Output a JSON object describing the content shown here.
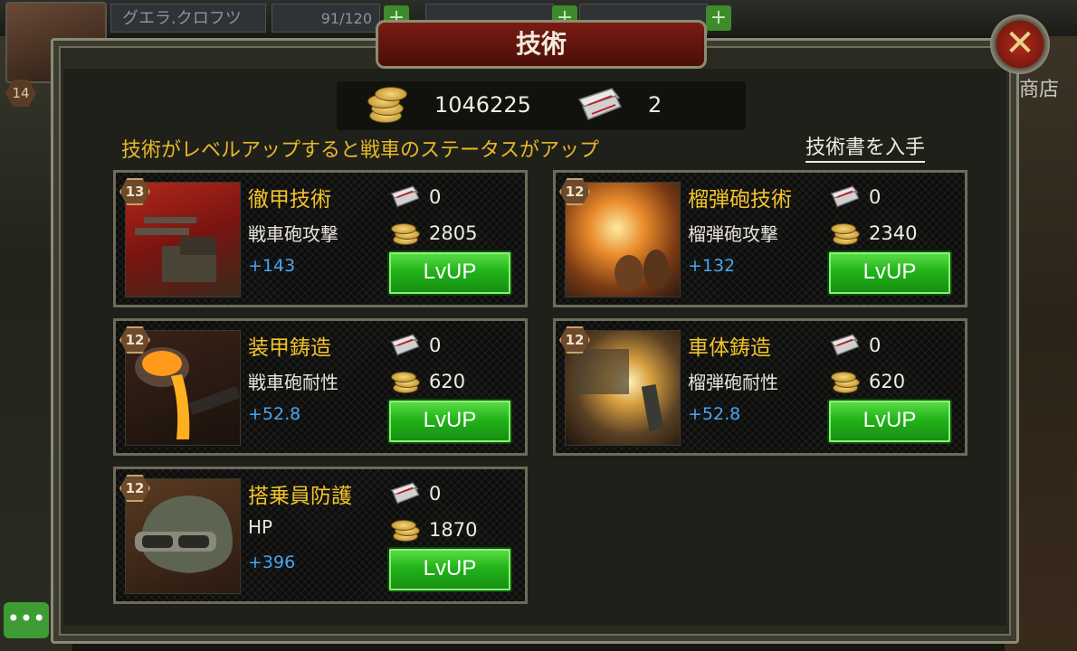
{
  "hud": {
    "level": "14",
    "player_name": "グエラ.クロフツ",
    "fuel": "91/120",
    "shop": "商店"
  },
  "window": {
    "title": "技術"
  },
  "resources": {
    "gold": "1046225",
    "tech_books": "2"
  },
  "hint": "技術がレベルアップすると戦車のステータスがアップ",
  "get_books_label": "技術書を入手",
  "cards": [
    {
      "level": "13",
      "name": "徹甲技術",
      "stat": "戦車砲攻撃",
      "bonus": "+143",
      "book_cost": "0",
      "gold_cost": "2805",
      "button": "LvUP"
    },
    {
      "level": "12",
      "name": "榴弾砲技術",
      "stat": "榴弾砲攻撃",
      "bonus": "+132",
      "book_cost": "0",
      "gold_cost": "2340",
      "button": "LvUP"
    },
    {
      "level": "12",
      "name": "装甲鋳造",
      "stat": "戦車砲耐性",
      "bonus": "+52.8",
      "book_cost": "0",
      "gold_cost": "620",
      "button": "LvUP"
    },
    {
      "level": "12",
      "name": "車体鋳造",
      "stat": "榴弾砲耐性",
      "bonus": "+52.8",
      "book_cost": "0",
      "gold_cost": "620",
      "button": "LvUP"
    },
    {
      "level": "12",
      "name": "搭乗員防護",
      "stat": "HP",
      "bonus": "+396",
      "book_cost": "0",
      "gold_cost": "1870",
      "button": "LvUP"
    }
  ]
}
